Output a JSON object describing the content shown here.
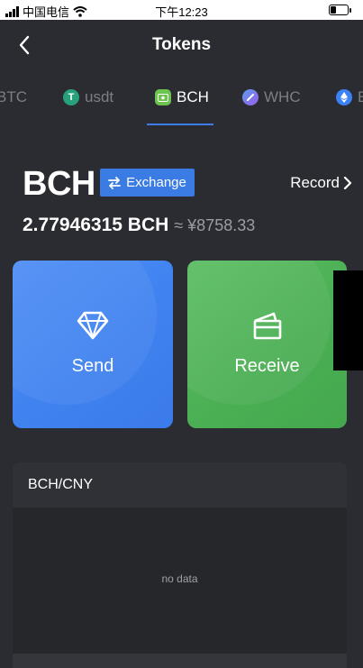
{
  "status_bar": {
    "carrier": "中国电信",
    "time": "下午12:23"
  },
  "header": {
    "title": "Tokens"
  },
  "tabs": [
    {
      "label": "BTC",
      "active": false,
      "icon": "btc-icon"
    },
    {
      "label": "usdt",
      "active": false,
      "icon": "tether-icon",
      "color": "#26a17b"
    },
    {
      "label": "BCH",
      "active": true,
      "icon": "bch-icon",
      "color": "#6cc34d"
    },
    {
      "label": "WHC",
      "active": false,
      "icon": "whc-icon",
      "color": "#8b6fe0"
    },
    {
      "label": "E",
      "active": false,
      "icon": "eth-icon",
      "color": "#3b82f6"
    }
  ],
  "balance": {
    "coin": "BCH",
    "exchange_label": "Exchange",
    "record_label": "Record",
    "amount": "2.77946315 BCH",
    "fiat": "≈ ¥8758.33"
  },
  "actions": {
    "send_label": "Send",
    "receive_label": "Receive"
  },
  "market": {
    "pair": "BCH/CNY",
    "empty_text": "no data"
  },
  "colors": {
    "background": "#2b2c31",
    "accent": "#3a7be4",
    "send_card": "#428bf2",
    "receive_card": "#4cb255"
  }
}
